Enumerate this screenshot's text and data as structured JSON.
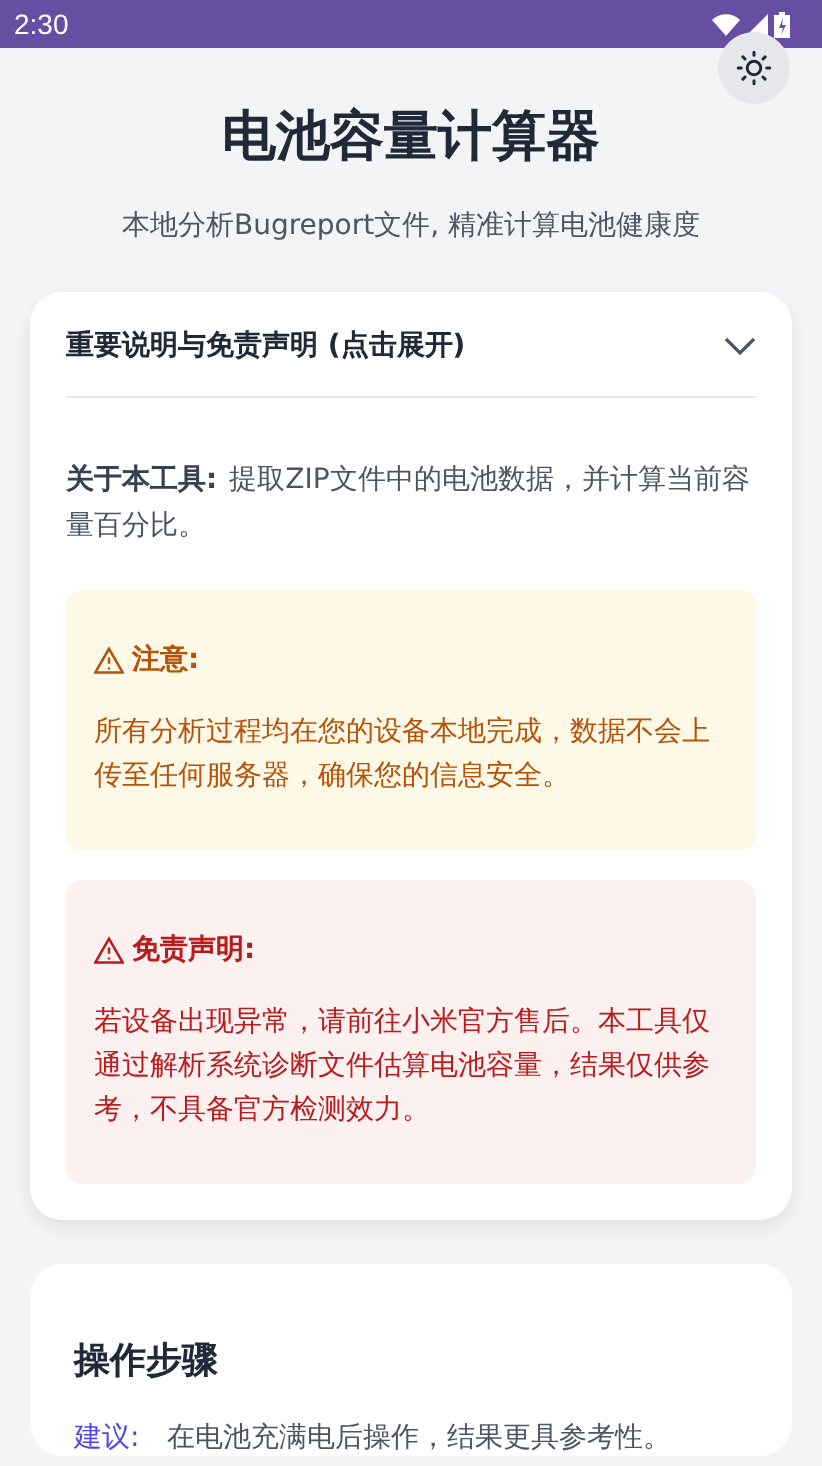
{
  "status_bar": {
    "time": "2:30"
  },
  "header": {
    "title": "电池容量计算器",
    "subtitle": "本地分析Bugreport文件, 精准计算电池健康度"
  },
  "notice_card": {
    "title": "重要说明与免责声明 (点击展开)",
    "about_label": "关于本工具:",
    "about_text": "提取ZIP文件中的电池数据，并计算当前容量百分比。",
    "alerts": [
      {
        "kind": "warning",
        "title": "注意:",
        "text": "所有分析过程均在您的设备本地完成，数据不会上传至任何服务器，确保您的信息安全。"
      },
      {
        "kind": "danger",
        "title": "免责声明:",
        "text": "若设备出现异常，请前往小米官方售后。本工具仅通过解析系统诊断文件估算电池容量，结果仅供参考，不具备官方检测效力。"
      }
    ]
  },
  "steps_card": {
    "title": "操作步骤",
    "tip_label": "建议:",
    "tip_text": "在电池充满电后操作，结果更具参考性。"
  }
}
